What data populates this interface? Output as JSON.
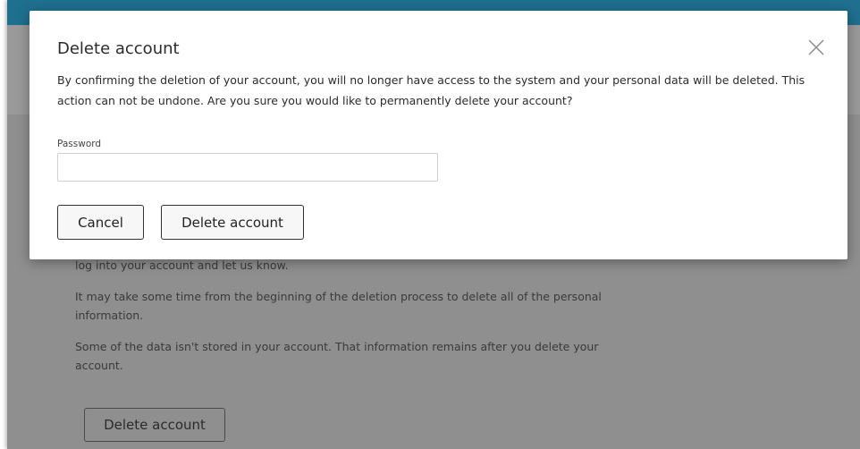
{
  "modal": {
    "title": "Delete account",
    "message": "By confirming the deletion of your account, you will no longer have access to the system and your personal data will be deleted. This action can not be undone. Are you sure you would like to permanently delete your account?",
    "password_label": "Password",
    "password_value": "",
    "cancel_label": "Cancel",
    "delete_label": "Delete account",
    "close_icon": "close-icon"
  },
  "background": {
    "paragraphs": [
      "log into your account and let us know.",
      "It may take some time from the beginning of the deletion process to delete all of the personal information.",
      "Some of the data isn't stored in your account. That information remains after you delete your account."
    ],
    "delete_button_label": "Delete account"
  },
  "colors": {
    "topbar": "#1f6f8f",
    "overlay": "#8f8f8f"
  }
}
